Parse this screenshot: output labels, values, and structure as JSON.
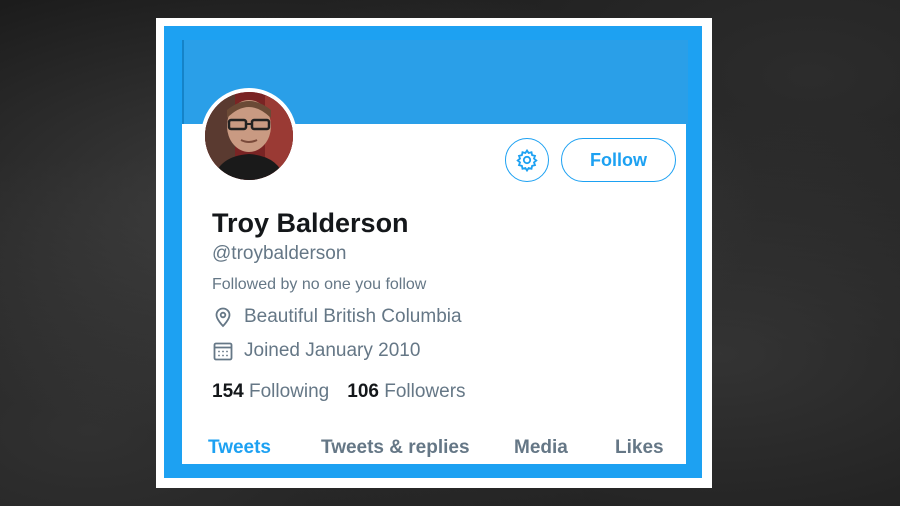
{
  "profile": {
    "name": "Troy Balderson",
    "handle": "@troybalderson",
    "followed_by": "Followed by no one you follow",
    "location": "Beautiful British Columbia",
    "joined": "Joined January 2010",
    "following_count": "154",
    "following_label": "Following",
    "followers_count": "106",
    "followers_label": "Followers"
  },
  "actions": {
    "settings_icon": "gear-icon",
    "follow_label": "Follow"
  },
  "tabs": [
    {
      "label": "Tweets",
      "active": true
    },
    {
      "label": "Tweets & replies",
      "active": false
    },
    {
      "label": "Media",
      "active": false
    },
    {
      "label": "Likes",
      "active": false
    }
  ],
  "colors": {
    "accent": "#1da1f2",
    "text_primary": "#14171a",
    "text_secondary": "#657786",
    "background": "#1c1c1c"
  }
}
